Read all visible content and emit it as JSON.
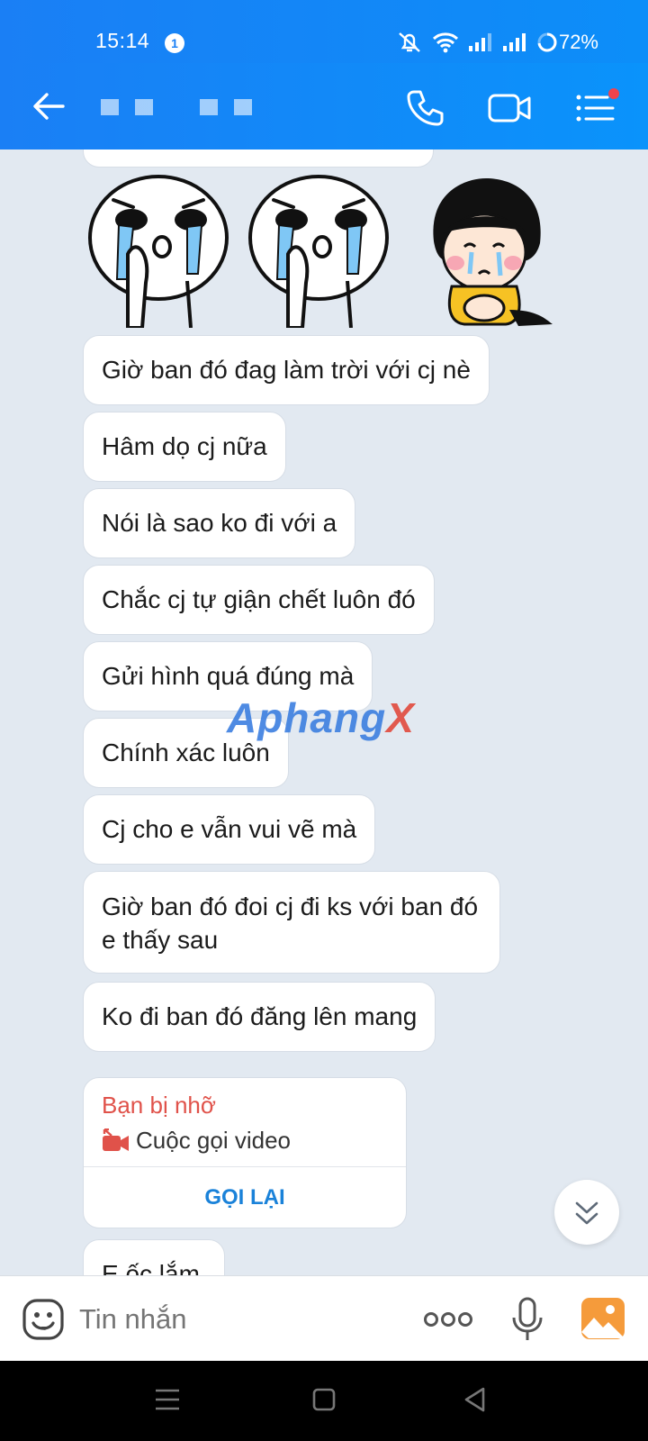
{
  "status_bar": {
    "time": "15:14",
    "notification_count": "1",
    "battery": "72%"
  },
  "header": {
    "contact_name": ""
  },
  "messages": [
    {
      "text": "Giờ ban đó đag làm trời với cj nè"
    },
    {
      "text": "Hâm dọ cj nữa"
    },
    {
      "text": "Nói là sao ko đi với a"
    },
    {
      "text": "Chắc cj tự giận chết luôn đó"
    },
    {
      "text": "Gửi hình quá đúng mà"
    },
    {
      "text": "Chính xác luôn"
    },
    {
      "text": "Cj cho e vẫn vui vẽ mà"
    },
    {
      "text": "Giờ ban đó đoi cj đi ks với ban đó e thấy sau"
    },
    {
      "text": "Ko đi ban đó đăng lên mang"
    }
  ],
  "missed_call": {
    "title": "Bạn bị nhỡ",
    "type": "Cuộc gọi video",
    "callback_label": "GỌI LẠI"
  },
  "partial_message": "E ốc lắm",
  "watermark": {
    "main": "Aphang",
    "accent": "X"
  },
  "input": {
    "placeholder": "Tin nhắn",
    "value": ""
  },
  "colors": {
    "header_blue": "#1a7ff5",
    "missed_red": "#e0524a",
    "link_blue": "#1a82d9",
    "chat_bg": "#e2e9f1"
  }
}
